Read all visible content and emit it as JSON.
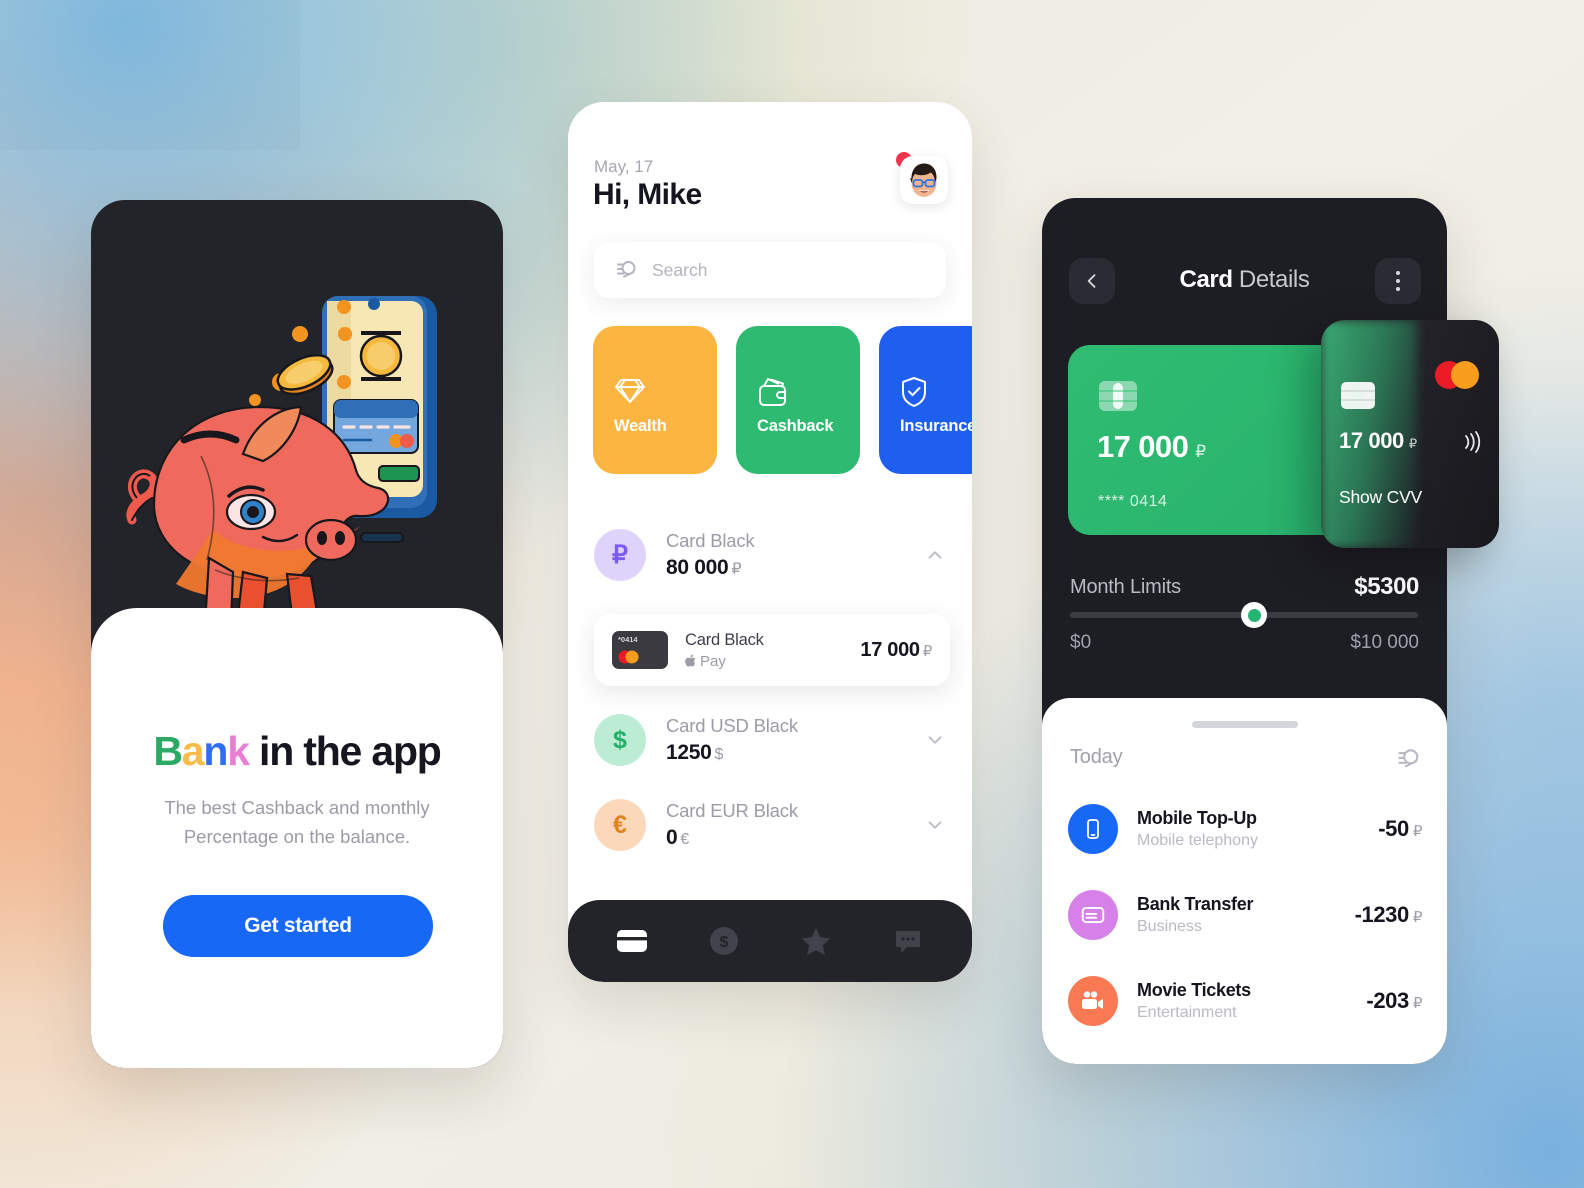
{
  "background": {
    "base_color": "#efeee7",
    "accent_blue": "#7dbae2",
    "accent_orange": "#f09669"
  },
  "onboarding": {
    "title_parts": [
      {
        "text": "B",
        "color": "#2aaa63"
      },
      {
        "text": "a",
        "color": "#fbbb4a"
      },
      {
        "text": "n",
        "color": "#2f6ef2"
      },
      {
        "text": "k",
        "color": "#e87fd5"
      },
      {
        "text": " in the app",
        "color": "#15161f"
      }
    ],
    "title_plain": "Bank in the app",
    "subtitle": "The best Cashback and monthly Percentage on the balance.",
    "cta_label": "Get started",
    "cta_color": "#1668f5",
    "illustration_name": "piggy-bank-phone-coins"
  },
  "home": {
    "date": "May, 17",
    "greeting": "Hi, Mike",
    "avatar_name": "memoji-avatar",
    "has_notification": true,
    "search": {
      "value": "",
      "placeholder": "Search"
    },
    "categories": [
      {
        "label": "Wealth",
        "icon": "diamond-icon",
        "color": "#fbb540"
      },
      {
        "label": "Cashback",
        "icon": "wallet-icon",
        "color": "#2fba72"
      },
      {
        "label": "Insurance",
        "icon": "shield-check-icon",
        "color": "#1e5ff0"
      }
    ],
    "accounts": [
      {
        "name": "Card Black",
        "balance": "80 000",
        "currency": "₽",
        "symbol": "₽",
        "circle_bg": "#ded4fb",
        "circle_fg": "#7c5cf0",
        "expanded": true
      },
      {
        "name": "Card USD Black",
        "balance": "1250",
        "currency": "$",
        "symbol": "$",
        "circle_bg": "#bdecd4",
        "circle_fg": "#22b06a",
        "expanded": false
      },
      {
        "name": "Card  EUR Black",
        "balance": "0",
        "currency": "€",
        "symbol": "€",
        "circle_bg": "#fcd8ba",
        "circle_fg": "#e0821f",
        "expanded": false
      }
    ],
    "sub_card": {
      "mini_number": "*0414",
      "name": "Card Black",
      "pay_label": "Pay",
      "pay_icon": "apple-icon",
      "amount": "17 000",
      "currency": "₽"
    },
    "tabs": [
      {
        "name": "cards",
        "icon": "card-icon",
        "active": true
      },
      {
        "name": "payments",
        "icon": "dollar-coin-icon",
        "active": false
      },
      {
        "name": "favorites",
        "icon": "star-icon",
        "active": false
      },
      {
        "name": "chat",
        "icon": "chat-icon",
        "active": false
      }
    ]
  },
  "card_details": {
    "title_bold": "Card",
    "title_light": "Details",
    "back_icon": "chevron-left-icon",
    "menu_icon": "more-vertical-icon",
    "green_card": {
      "amount": "17 000",
      "currency": "₽",
      "masked_number": "**** 0414",
      "color": "#2fbd72",
      "chip_icon": "chip-icon"
    },
    "dark_card": {
      "amount": "17 000",
      "currency": "₽",
      "cvv_label": "Show CVV",
      "brand_icon": "mastercard-icon",
      "contactless_icon": "contactless-icon",
      "chip_icon": "chip-icon"
    },
    "limits": {
      "label": "Month Limits",
      "value": "$5300",
      "min": "$0",
      "max": "$10 000",
      "percent": 53
    },
    "transactions_header": "Today",
    "filter_icon": "filter-search-icon",
    "transactions": [
      {
        "title": "Mobile Top-Up",
        "subtitle": "Mobile telephony",
        "amount": "-50",
        "currency": "₽",
        "icon": "smartphone-icon",
        "color": "#1668f5"
      },
      {
        "title": "Bank Transfer",
        "subtitle": "Business",
        "amount": "-1230",
        "currency": "₽",
        "icon": "credit-card-icon",
        "color": "#d681e8"
      },
      {
        "title": "Movie Tickets",
        "subtitle": "Entertainment",
        "amount": "-203",
        "currency": "₽",
        "icon": "movie-camera-icon",
        "color": "#f97a52"
      }
    ]
  }
}
